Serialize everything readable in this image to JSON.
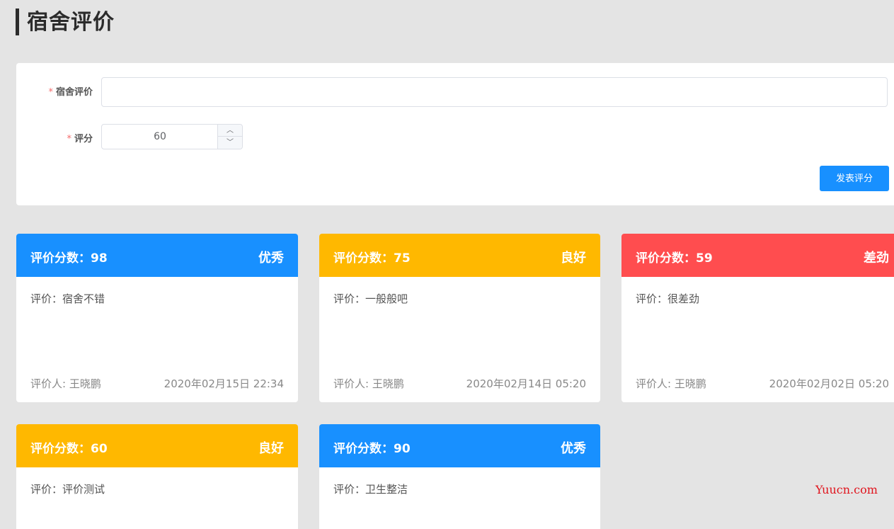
{
  "page": {
    "title": "宿舍评价"
  },
  "form": {
    "review_label": "宿舍评价",
    "review_value": "",
    "score_label": "评分",
    "score_value": "60",
    "required_mark": "*",
    "stepper_up": "︿",
    "stepper_down": "﹀",
    "submit_label": "发表评分"
  },
  "colors": {
    "excellent": "#1890ff",
    "good": "#ffb800",
    "poor": "#ff4d4f",
    "accent": "#1890ff"
  },
  "reviews": [
    {
      "score": "评价分数：98",
      "grade": "优秀",
      "comment": "评价：宿舍不错",
      "author": "评价人: 王晓鹏",
      "date": "2020年02月15日 22:34"
    },
    {
      "score": "评价分数：75",
      "grade": "良好",
      "comment": "评价：一般般吧",
      "author": "评价人: 王晓鹏",
      "date": "2020年02月14日 05:20"
    },
    {
      "score": "评价分数：59",
      "grade": "差劲",
      "comment": "评价：很差劲",
      "author": "评价人: 王晓鹏",
      "date": "2020年02月02日 05:20"
    },
    {
      "score": "评价分数：60",
      "grade": "良好",
      "comment": "评价：评价测试",
      "author": "",
      "date": ""
    },
    {
      "score": "评价分数：90",
      "grade": "优秀",
      "comment": "评价：卫生整洁",
      "author": "",
      "date": ""
    }
  ],
  "watermark": "Yuucn.com"
}
